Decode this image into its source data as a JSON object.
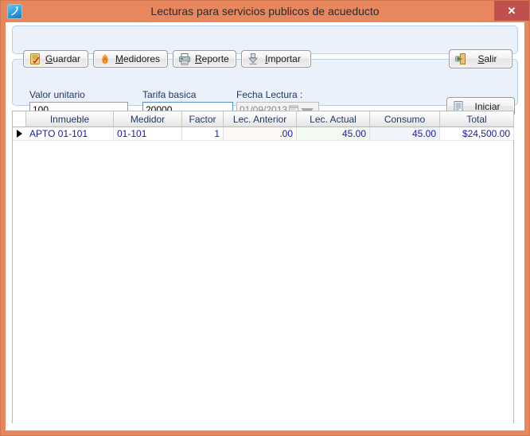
{
  "window": {
    "title": "Lecturas para servicios publicos de acueducto",
    "app_icon": "app-logo-icon",
    "close_label": "✕",
    "frame_color": "#e8865e",
    "close_button_color": "#c0504d"
  },
  "toolbar": {
    "buttons": [
      {
        "id": "guardar",
        "label_pre": "",
        "label_accel": "G",
        "label_post": "uardar",
        "text": "Guardar",
        "icon": "save-note-icon"
      },
      {
        "id": "medidores",
        "label_pre": "",
        "label_accel": "M",
        "label_post": "edidores",
        "text": "Medidores",
        "icon": "flame-icon"
      },
      {
        "id": "reporte",
        "label_pre": "",
        "label_accel": "R",
        "label_post": "eporte",
        "text": "Reporte",
        "icon": "printer-icon"
      },
      {
        "id": "importar",
        "label_pre": "",
        "label_accel": "I",
        "label_post": "mportar",
        "text": "Importar",
        "icon": "import-down-arrow-icon"
      },
      {
        "id": "salir",
        "label_pre": "",
        "label_accel": "S",
        "label_post": "alir",
        "text": "Salir",
        "icon": "exit-door-icon"
      }
    ]
  },
  "fields": {
    "valor_unitario": {
      "label": "Valor unitario",
      "value": "100",
      "placeholder": ""
    },
    "tarifa_basica": {
      "label": "Tarifa basica",
      "value": "20000",
      "placeholder": ""
    },
    "fecha_lectura": {
      "label": "Fecha Lectura :",
      "value": "01/09/2013",
      "enabled": false,
      "calendar_icon": "calendar-icon",
      "dropdown_icon": "chevron-down-icon"
    },
    "iniciar_button": {
      "label_accel": "I",
      "label_post": "niciar",
      "text": "Iniciar",
      "icon": "document-icon"
    }
  },
  "grid": {
    "row_selector_icon": "row-selector-arrow-icon",
    "columns": [
      {
        "header": "Inmueble",
        "width": 110,
        "align": "align-left",
        "bg": "#ffffff"
      },
      {
        "header": "Medidor",
        "width": 86,
        "align": "align-left",
        "bg": "#ffffff"
      },
      {
        "header": "Factor",
        "width": 52,
        "align": "align-right",
        "bg": "#ffffff"
      },
      {
        "header": "Lec. Anterior",
        "width": 92,
        "align": "align-right",
        "bg": "#fdf8f3"
      },
      {
        "header": "Lec. Actual",
        "width": 92,
        "align": "align-right",
        "bg": "#f3faf0"
      },
      {
        "header": "Consumo",
        "width": 88,
        "align": "align-right",
        "bg": "#f2f4fc"
      },
      {
        "header": "Total",
        "width": 93,
        "align": "align-right",
        "bg": "#ffffff"
      }
    ],
    "rows": [
      {
        "selected": true,
        "cells": [
          "APTO 01-101",
          "01-101",
          "1",
          ".00",
          "45.00",
          "45.00",
          "$24,500.00"
        ]
      }
    ]
  }
}
